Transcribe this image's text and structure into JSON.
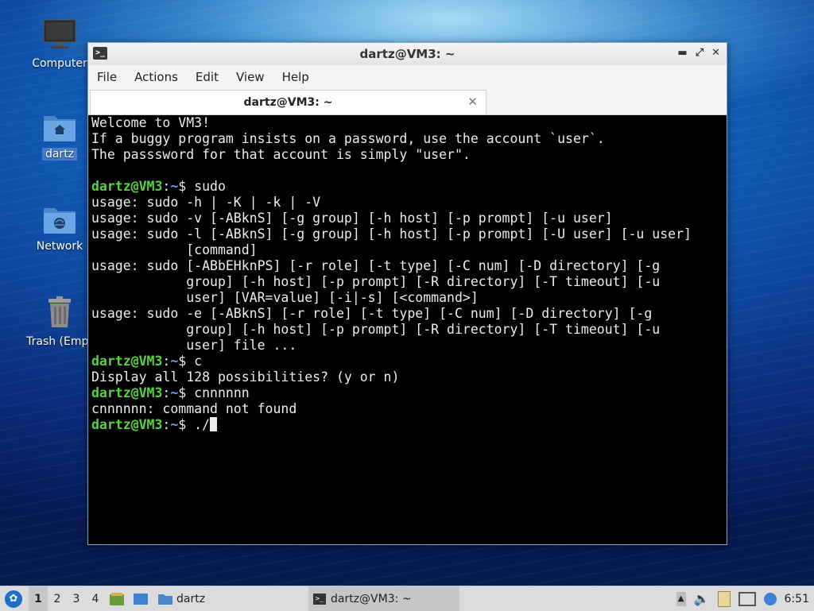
{
  "desktop": {
    "icons": [
      {
        "label": "Computer",
        "icon": "monitor-icon"
      },
      {
        "label": "dartz",
        "icon": "home-folder-icon"
      },
      {
        "label": "Network",
        "icon": "network-folder-icon"
      },
      {
        "label": "Trash (Empt",
        "icon": "trash-icon"
      }
    ]
  },
  "window": {
    "title": "dartz@VM3: ~",
    "menu": [
      "File",
      "Actions",
      "Edit",
      "View",
      "Help"
    ],
    "tab_title": "dartz@VM3: ~",
    "tab_close_glyph": "✕",
    "prompt": {
      "user_host": "dartz@VM3",
      "sep": ":",
      "path": "~",
      "symbol": "$ "
    },
    "terminal_lines": [
      {
        "text": "Welcome to VM3!"
      },
      {
        "text": "If a buggy program insists on a password, use the account `user`."
      },
      {
        "text": "The passsword for that account is simply \"user\"."
      },
      {
        "text": ""
      },
      {
        "prompt": true,
        "cmd": "sudo"
      },
      {
        "text": "usage: sudo -h | -K | -k | -V"
      },
      {
        "text": "usage: sudo -v [-ABknS] [-g group] [-h host] [-p prompt] [-u user]"
      },
      {
        "text": "usage: sudo -l [-ABknS] [-g group] [-h host] [-p prompt] [-U user] [-u user]"
      },
      {
        "text": "            [command]"
      },
      {
        "text": "usage: sudo [-ABbEHknPS] [-r role] [-t type] [-C num] [-D directory] [-g"
      },
      {
        "text": "            group] [-h host] [-p prompt] [-R directory] [-T timeout] [-u"
      },
      {
        "text": "            user] [VAR=value] [-i|-s] [<command>]"
      },
      {
        "text": "usage: sudo -e [-ABknS] [-r role] [-t type] [-C num] [-D directory] [-g"
      },
      {
        "text": "            group] [-h host] [-p prompt] [-R directory] [-T timeout] [-u"
      },
      {
        "text": "            user] file ..."
      },
      {
        "prompt": true,
        "cmd": "c"
      },
      {
        "text": "Display all 128 possibilities? (y or n)"
      },
      {
        "prompt": true,
        "cmd": "cnnnnnn"
      },
      {
        "text": "cnnnnnn: command not found"
      },
      {
        "prompt": true,
        "cmd": "./",
        "cursor": true
      }
    ],
    "colors": {
      "prompt_user": "#55d43c",
      "prompt_path": "#6fa0ff",
      "text": "#ececec",
      "background": "#000000"
    }
  },
  "taskbar": {
    "workspaces": [
      "1",
      "2",
      "3",
      "4"
    ],
    "active_workspace": "1",
    "file_manager_task": "dartz",
    "terminal_task": "dartz@VM3: ~",
    "clock": "6:51"
  }
}
